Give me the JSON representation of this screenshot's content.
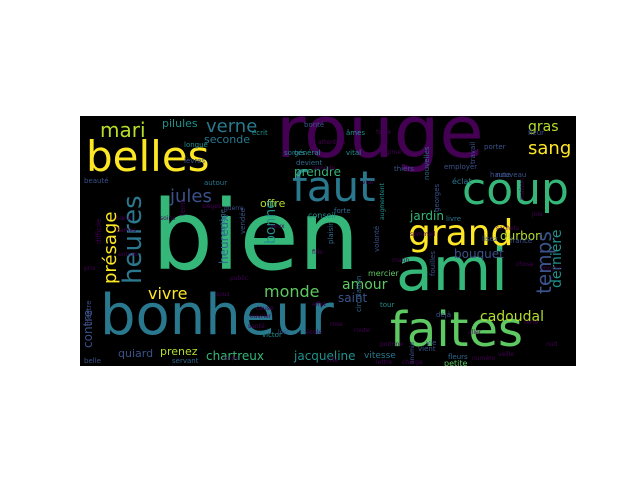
{
  "palette": {
    "purple": "#440154",
    "indigo": "#3b528b",
    "blue": "#31688e",
    "teal": "#21918c",
    "sea": "#2a788e",
    "green": "#35b779",
    "lime": "#5ec962",
    "yellow": "#fde725",
    "olive": "#b5de2b"
  },
  "words": {
    "rouge": "rouge",
    "bien": "bien",
    "ami": "ami",
    "bonheur": "bonheur",
    "faites": "faites",
    "belles": "belles",
    "faut": "faut",
    "coup": "coup",
    "grand": "grand",
    "heures": "heures",
    "presage": "présage",
    "verne": "verne",
    "mari": "mari",
    "jules": "jules",
    "sang": "sang",
    "gras": "gras",
    "temps": "temps",
    "vivre": "vivre",
    "monde": "monde",
    "amour": "amour",
    "bonne": "bonne",
    "heureux": "heureux",
    "bouquet": "bouquet",
    "durbon": "durbon",
    "cadoudal": "cadoudal",
    "contre": "contre",
    "derniere": "dernière",
    "chartreux": "chartreux",
    "jacqueline": "jacqueline",
    "quiard": "quiard",
    "prenez": "prenez",
    "pilules": "pilules",
    "seconde": "seconde",
    "offre": "offre",
    "prendre": "prendre",
    "saint": "saint",
    "jardin": "jardin",
    "conseil": "conseil",
    "vitesse": "vitesse",
    "mercier": "mercier",
    "eclat": "éclat",
    "petite": "petite",
    "beaute": "beauté",
    "ecrit": "écrit",
    "longue": "longue",
    "levres": "lèvres",
    "vital": "vital",
    "devient": "devient",
    "general": "général",
    "employer": "employer",
    "nouvelles": "nouvelles",
    "travail": "travail",
    "porter": "porter",
    "fleur": "fleur",
    "maison": "maison",
    "difficile": "difficile",
    "cortege": "cortège",
    "victor": "victor",
    "servant": "servant",
    "nouveau": "nouveau",
    "thiers": "thiers",
    "livre": "livre",
    "fleurs": "fleurs",
    "vie": "vie",
    "vient": "vient",
    "belle": "belle",
    "theatre": "théâtre",
    "fouilles": "fouilles",
    "france": "france",
    "georges": "georges",
    "teint": "teint",
    "autour": "autour",
    "forte": "forte",
    "volonte": "volonté",
    "sortes": "sortes",
    "plaisir": "plaisir",
    "circulation": "circulation",
    "deja": "déjà",
    "tour": "tour",
    "haute": "haute",
    "bonte": "bonté",
    "ames": "âmes",
    "augmentent": "augmentent",
    "anemie": "anémie",
    "vendee": "vendée",
    "lisez": "lisez",
    "coeur": "cœur",
    "soins": "soins",
    "yeux": "yeux",
    "fille": "fille",
    "guerre": "guerre",
    "remede": "remède",
    "regime": "régime",
    "ouvrier": "ouvrier",
    "sante": "santé",
    "jours": "jours",
    "caisse": "caisse",
    "numero": "numéro",
    "effet": "effet",
    "cause": "cause",
    "loin": "loin",
    "ecole": "école",
    "sommeil": "sommeil",
    "sachets": "sachets",
    "ennuis": "ennuis",
    "corps": "corps",
    "lettre": "lettre",
    "matin": "matin",
    "chose": "chose",
    "moyen": "moyen",
    "nuit": "nuit",
    "sieges": "sièges",
    "public": "public",
    "force": "force",
    "rose": "rose",
    "joie": "joie",
    "prix": "prix",
    "ville": "ville",
    "dames": "dames",
    "poitrine": "poitrine",
    "terre": "terre",
    "route": "route",
    "sous": "sous",
    "aller": "aller",
    "veille": "veille",
    "attention": "attention",
    "vrai": "vrai",
    "charge": "charge"
  }
}
